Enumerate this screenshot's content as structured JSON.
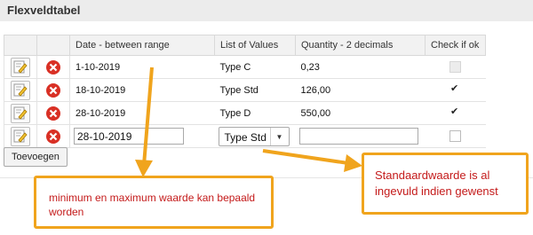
{
  "panel": {
    "title": "Flexveldtabel"
  },
  "table": {
    "columns": [
      "",
      "",
      "Date - between range",
      "List of Values",
      "Quantity - 2 decimals",
      "Check if ok"
    ],
    "rows": [
      {
        "date": "1-10-2019",
        "list_value": "Type C",
        "quantity": "0,23",
        "checked": "disabled"
      },
      {
        "date": "18-10-2019",
        "list_value": "Type Std",
        "quantity": "126,00",
        "checked": "checked"
      },
      {
        "date": "28-10-2019",
        "list_value": "Type D",
        "quantity": "550,00",
        "checked": "checked"
      }
    ],
    "edit_row": {
      "date_value": "28-10-2019",
      "list_selected": "Type Std",
      "quantity_value": "",
      "checked": "unchecked"
    }
  },
  "buttons": {
    "add": "Toevoegen"
  },
  "annotations": {
    "callout_range": "minimum en maximum waarde kan bepaald worden",
    "callout_default": "Standaardwaarde is al ingevuld indien gewenst"
  },
  "colors": {
    "accent": "#f0a41d",
    "annotation_text": "#c41a1a",
    "delete_icon": "#d93025"
  }
}
